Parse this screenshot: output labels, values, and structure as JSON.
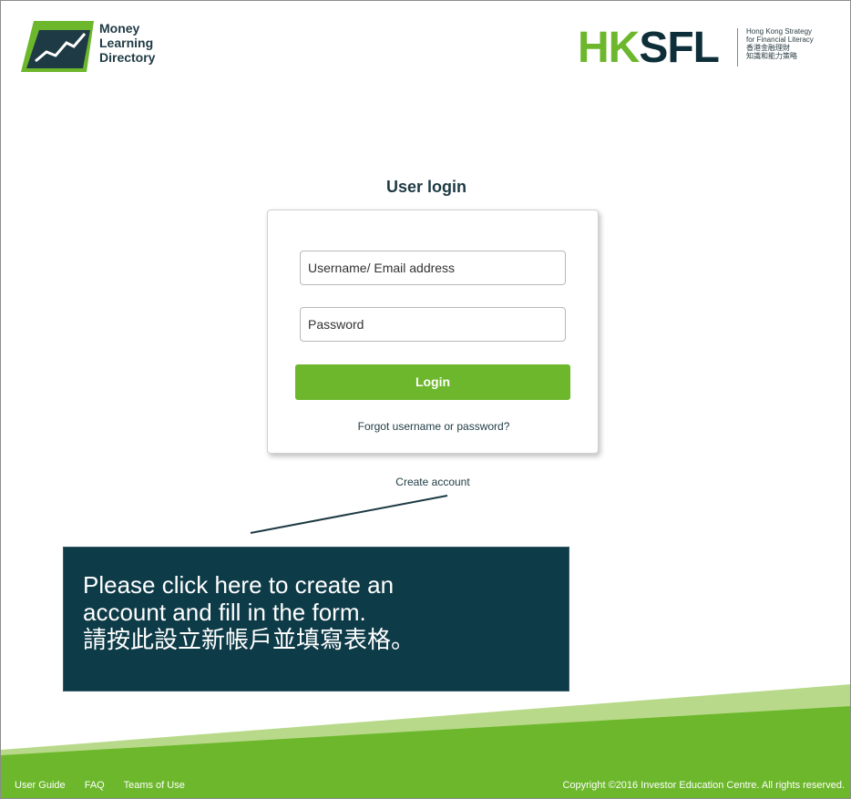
{
  "brand": {
    "lines": [
      "Money",
      "Learning",
      "Directory"
    ]
  },
  "partner": {
    "logo_text_a": "HK",
    "logo_text_b": "SFL",
    "tagline": [
      "Hong Kong Strategy",
      "for Financial Literacy",
      "香港金融理財",
      "知識和能力策略"
    ]
  },
  "login": {
    "title": "User login",
    "username_placeholder": "Username/ Email address",
    "password_placeholder": "Password",
    "button_label": "Login",
    "forgot_link": "Forgot username or password?",
    "create_link": "Create account"
  },
  "callout": {
    "lines": [
      "Please click here to create an",
      "account and fill in the form.",
      "請按此設立新帳戶並填寫表格。"
    ]
  },
  "footer": {
    "links": [
      "User Guide",
      "FAQ",
      "Teams of Use"
    ],
    "copyright": "Copyright ©2016 Investor Education Centre. All rights reserved."
  },
  "colors": {
    "brand_green": "#6cb72b",
    "brand_navy": "#0e2f3a",
    "callout_bg": "#0e3b48",
    "footer_green": "#6cb72b",
    "footer_light_green": "#b8d98a"
  }
}
